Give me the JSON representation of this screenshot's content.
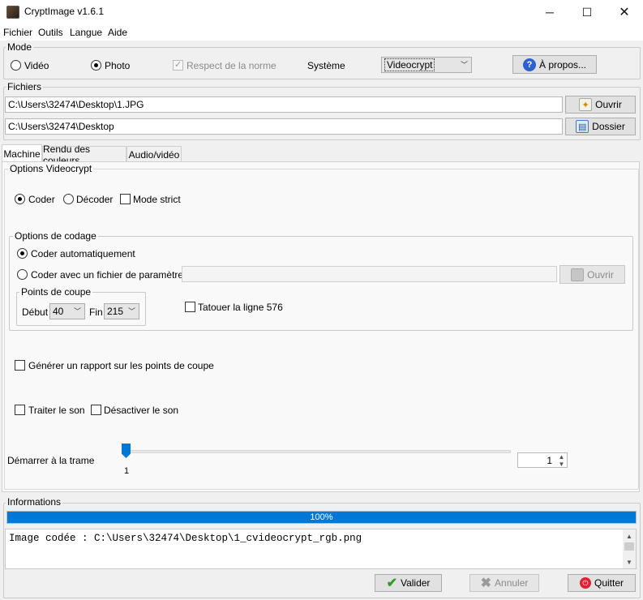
{
  "window": {
    "title": "CryptImage v1.6.1"
  },
  "menu": [
    "Fichier",
    "Outils",
    "Langue",
    "Aide"
  ],
  "mode": {
    "label": "Mode",
    "video": "Vidéo",
    "photo": "Photo",
    "respect": "Respect de la norme",
    "system_label": "Système",
    "system_value": "Videocrypt",
    "about": "À propos..."
  },
  "files": {
    "label": "Fichiers",
    "input_path": "C:\\Users\\32474\\Desktop\\1.JPG",
    "output_path": "C:\\Users\\32474\\Desktop",
    "open_btn": "Ouvrir",
    "folder_btn": "Dossier"
  },
  "tabs": [
    "Machine",
    "Rendu des couleurs",
    "Audio/vidéo"
  ],
  "videocrypt": {
    "label": "Options Videocrypt",
    "coder": "Coder",
    "decoder": "Décoder",
    "strict": "Mode strict",
    "coding": {
      "label": "Options de codage",
      "auto": "Coder automatiquement",
      "param": "Coder avec un fichier de paramètres",
      "param_path": "",
      "param_open": "Ouvrir",
      "cut": {
        "label": "Points de coupe",
        "start_label": "Début",
        "start": "40",
        "end_label": "Fin",
        "end": "215"
      },
      "tattoo": "Tatouer la ligne 576"
    },
    "report": "Générer un rapport sur les points de coupe",
    "sound": "Traiter le son",
    "disable_sound": "Désactiver le son",
    "frame_label": "Démarrer à la trame",
    "frame_tick": "1",
    "frame_value": "1"
  },
  "info": {
    "label": "Informations",
    "progress": 1.0,
    "progress_text": "100%",
    "log": "Image codée : C:\\Users\\32474\\Desktop\\1_cvideocrypt_rgb.png"
  },
  "buttons": {
    "validate": "Valider",
    "cancel": "Annuler",
    "quit": "Quitter"
  },
  "colors": {
    "progress": "#0078d7",
    "accent": "#0078d7"
  }
}
